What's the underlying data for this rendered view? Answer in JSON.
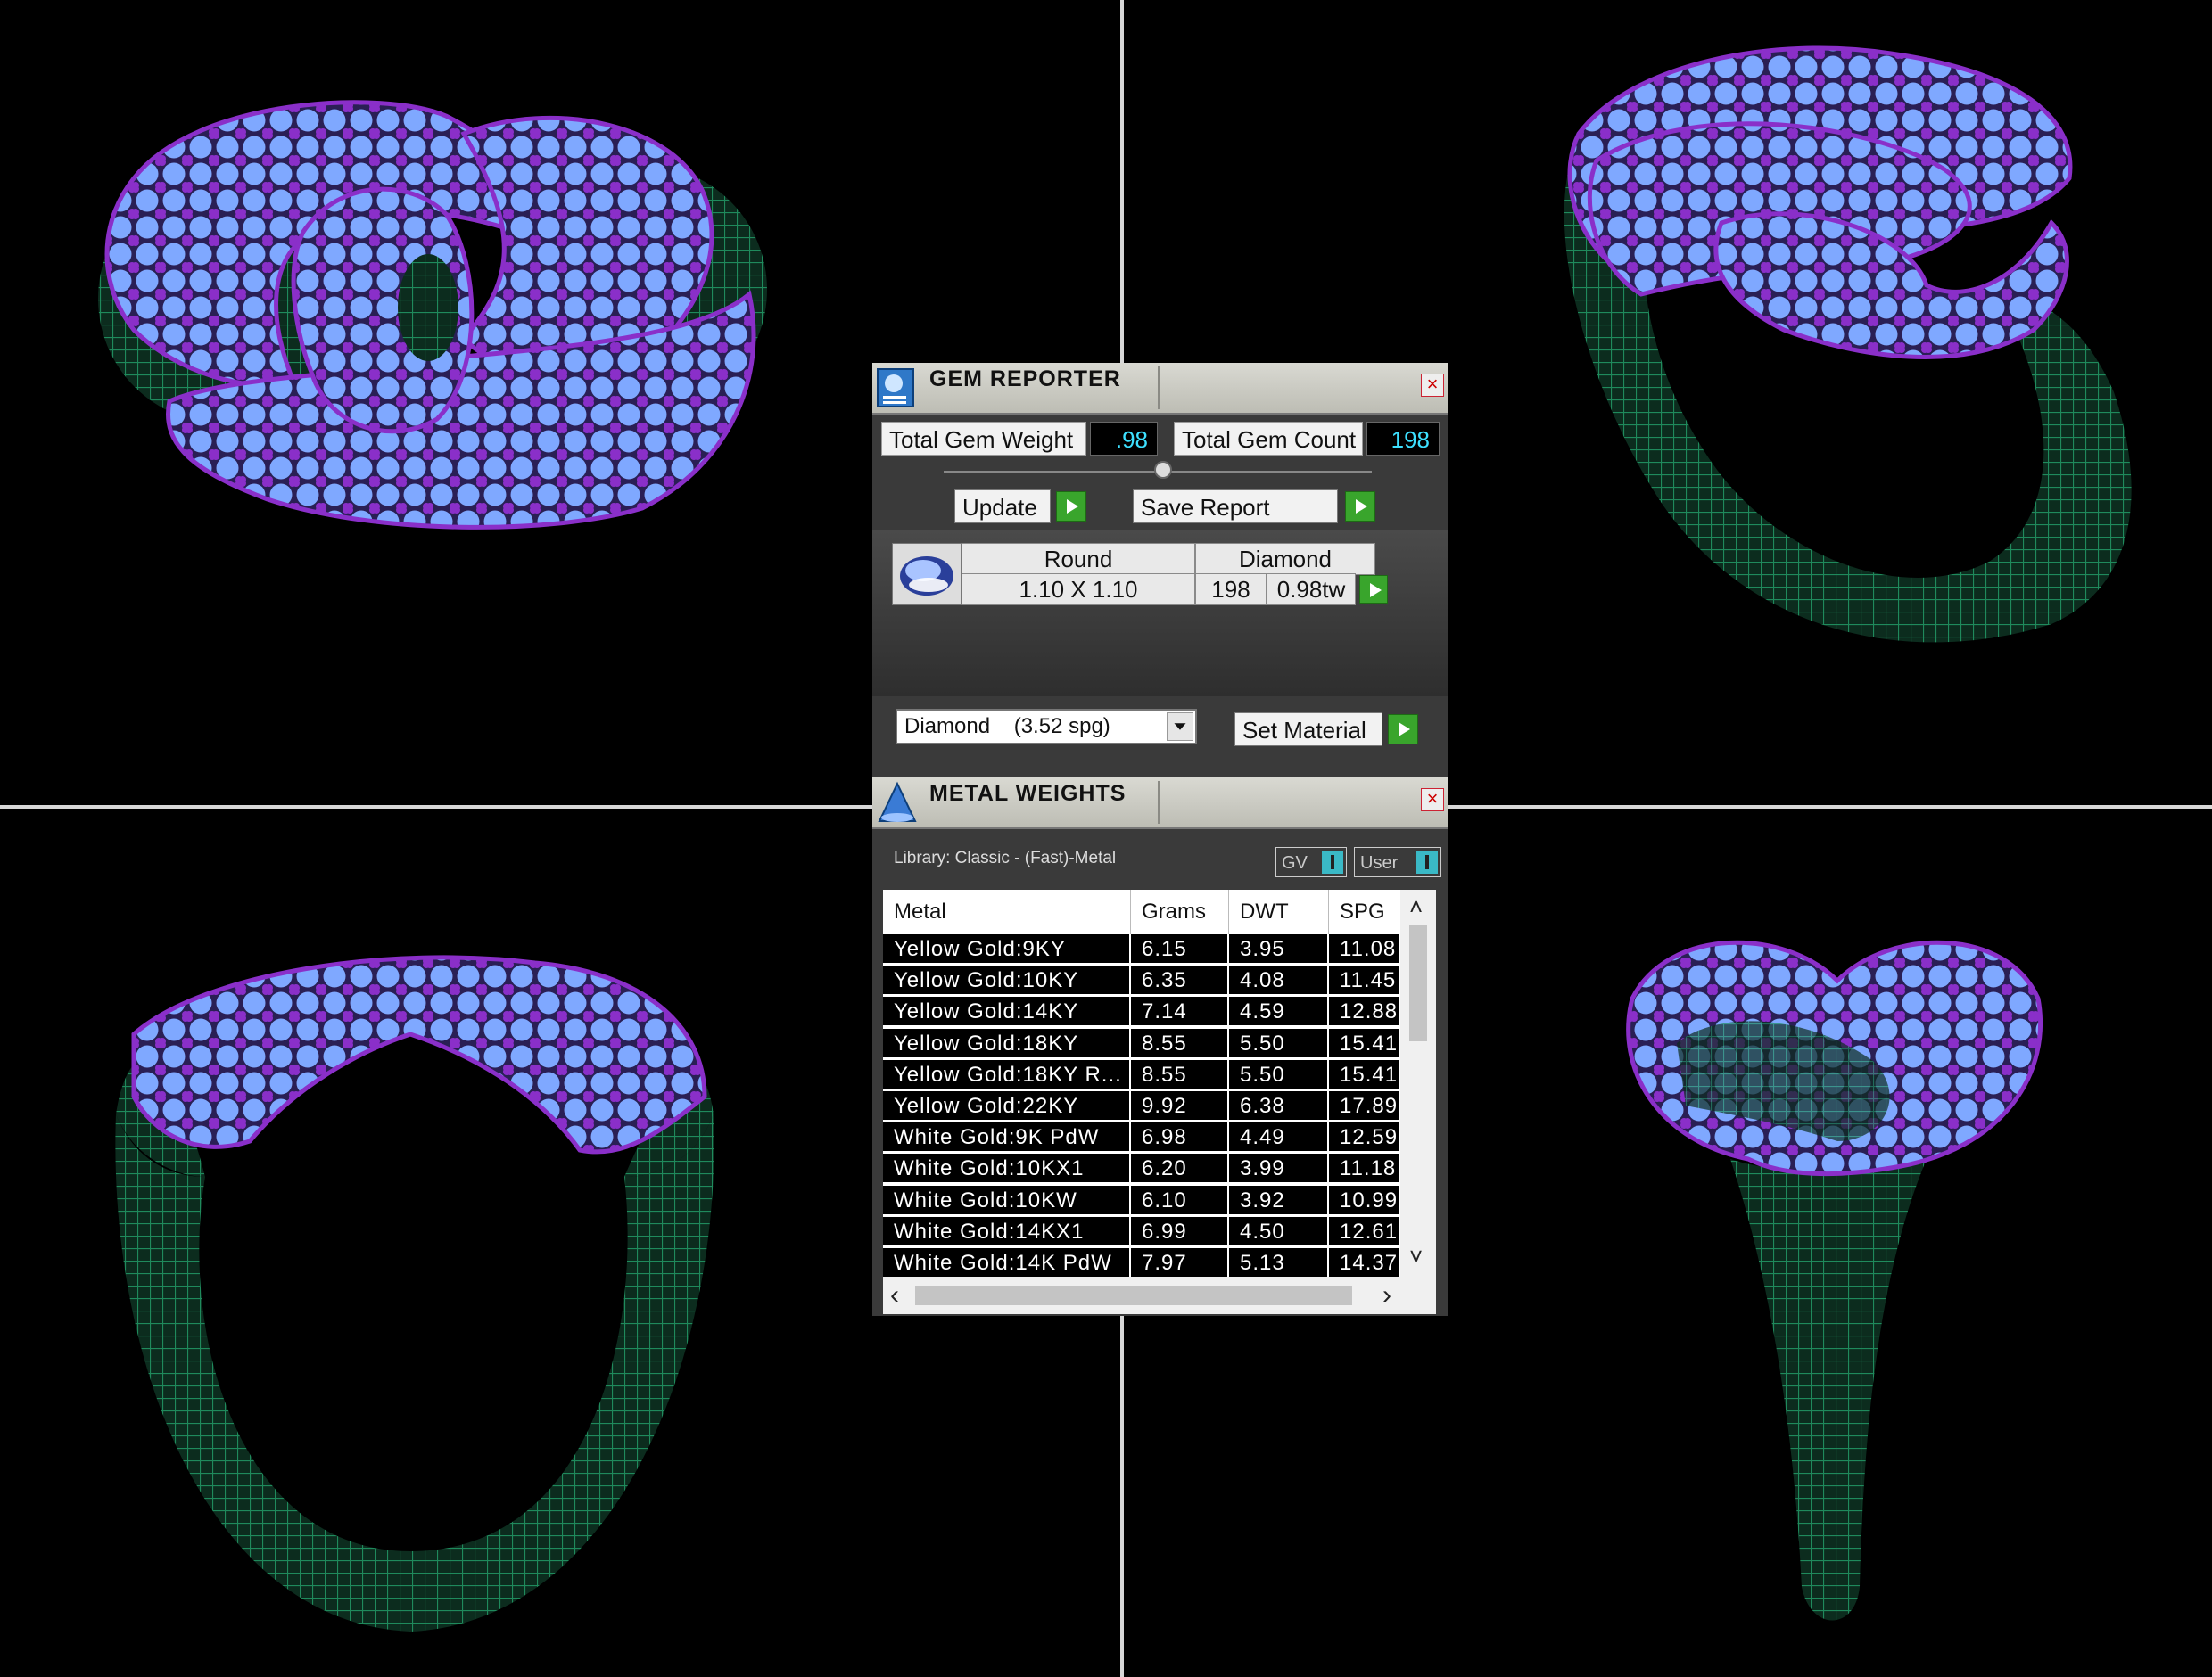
{
  "gem_reporter": {
    "title": "GEM REPORTER",
    "total_gem_weight_label": "Total Gem Weight",
    "total_gem_weight_value": ".98",
    "total_gem_count_label": "Total Gem Count",
    "total_gem_count_value": "198",
    "update_label": "Update",
    "save_report_label": "Save Report",
    "gem_row": {
      "shape": "Round",
      "material": "Diamond",
      "size": "1.10 X 1.10",
      "count": "198",
      "weight": "0.98tw"
    },
    "material_select_value": "Diamond    (3.52 spg)",
    "set_material_label": "Set Material",
    "close_glyph": "×"
  },
  "metal_weights": {
    "title": "METAL WEIGHTS",
    "library_label": "Library: Classic - (Fast)-Metal",
    "gv_label": "GV",
    "user_label": "User",
    "close_glyph": "×",
    "columns": [
      "Metal",
      "Grams",
      "DWT",
      "SPG"
    ],
    "rows": [
      [
        "Yellow Gold:9KY",
        "6.15",
        "3.95",
        "11.08"
      ],
      [
        "Yellow Gold:10KY",
        "6.35",
        "4.08",
        "11.45"
      ],
      [
        "Yellow Gold:14KY",
        "7.14",
        "4.59",
        "12.88"
      ],
      [
        "Yellow Gold:18KY",
        "8.55",
        "5.50",
        "15.41"
      ],
      [
        "Yellow Gold:18KY R...",
        "8.55",
        "5.50",
        "15.41"
      ],
      [
        "Yellow Gold:22KY",
        "9.92",
        "6.38",
        "17.89"
      ],
      [
        "White Gold:9K PdW",
        "6.98",
        "4.49",
        "12.59"
      ],
      [
        "White Gold:10KX1",
        "6.20",
        "3.99",
        "11.18"
      ],
      [
        "White Gold:10KW",
        "6.10",
        "3.92",
        "10.99"
      ],
      [
        "White Gold:14KX1",
        "6.99",
        "4.50",
        "12.61"
      ],
      [
        "White Gold:14K PdW",
        "7.97",
        "5.13",
        "14.37"
      ]
    ],
    "scroll_up": "˄",
    "scroll_down": "˅",
    "scroll_left": "‹",
    "scroll_right": "›"
  },
  "colors": {
    "background": "#000000",
    "wire": "#1f8a5c",
    "gem": "#7fa8ff",
    "prong": "#8a2fc9",
    "accent_value": "#3de0ff",
    "button_green": "#39a52c"
  }
}
